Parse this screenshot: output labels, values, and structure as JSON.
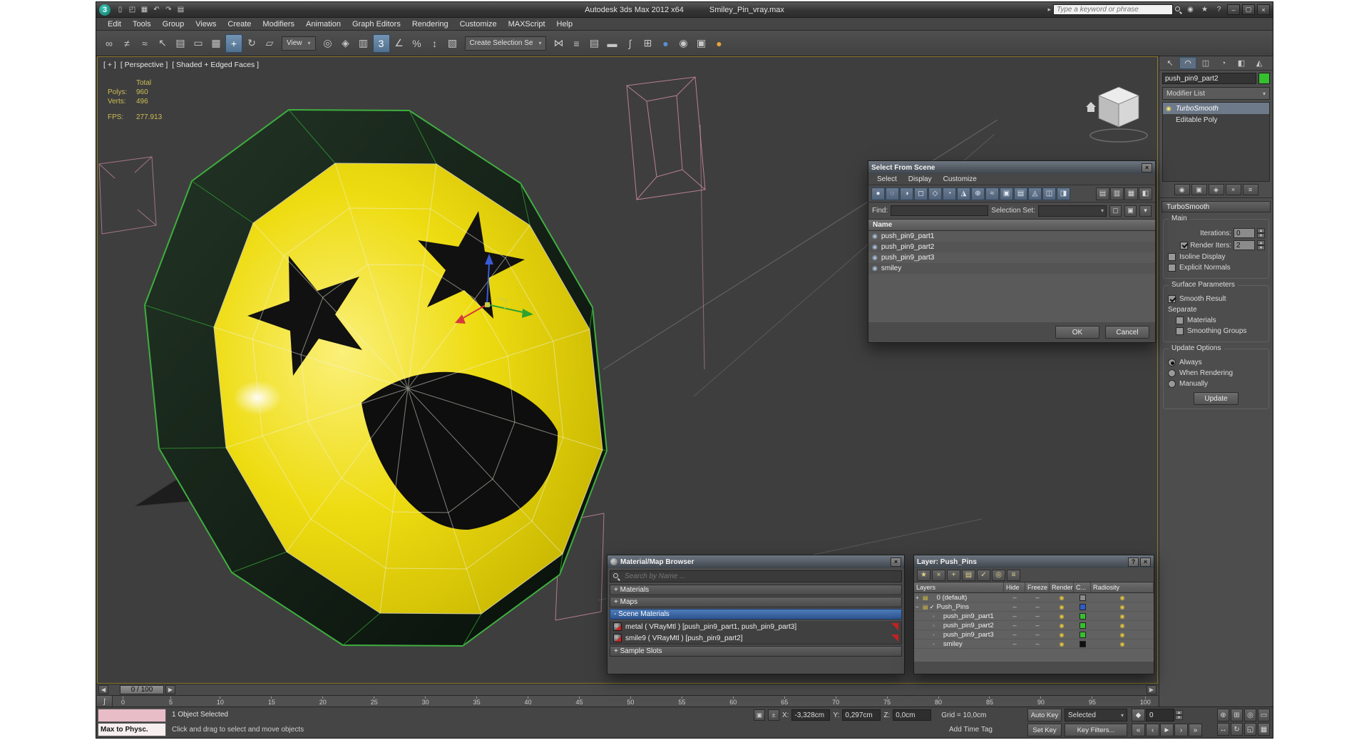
{
  "glyphs": {
    "close": "×",
    "help": "?",
    "minimize": "–",
    "maximize": "▢",
    "combo_arrow": "▾",
    "spin_up": "▴",
    "spin_down": "▾",
    "left": "◀",
    "right": "▶",
    "t_start": "«",
    "t_prev": "‹",
    "t_play": "►",
    "t_next": "›",
    "t_end": "»",
    "check": "✓",
    "curve": "∫",
    "key": "◆",
    "lock": "▣",
    "abs": "±",
    "geometry": "◉",
    "render_dot": "◉",
    "collapse": "▸"
  },
  "window": {
    "app_title": "Autodesk 3ds Max 2012 x64",
    "doc_title": "Smiley_Pin_vray.max",
    "search_placeholder": "Type a keyword or phrase"
  },
  "quick_access": [
    {
      "name": "new-scene-icon",
      "glyph": "▯"
    },
    {
      "name": "open-file-icon",
      "glyph": "◰"
    },
    {
      "name": "save-file-icon",
      "glyph": "▦"
    },
    {
      "name": "undo-icon",
      "glyph": "↶"
    },
    {
      "name": "redo-icon",
      "glyph": "↷"
    },
    {
      "name": "project-folder-icon",
      "glyph": "▤"
    }
  ],
  "infocenter": [
    {
      "name": "sign-in-icon",
      "glyph": "◉"
    },
    {
      "name": "favorites-icon",
      "glyph": "★"
    },
    {
      "name": "help-icon",
      "glyph": "?"
    }
  ],
  "menus": [
    "Edit",
    "Tools",
    "Group",
    "Views",
    "Create",
    "Modifiers",
    "Animation",
    "Graph Editors",
    "Rendering",
    "Customize",
    "MAXScript",
    "Help"
  ],
  "toolbar": {
    "view_combo": "View",
    "selection_combo": "Create Selection Se",
    "items_a": [
      {
        "name": "select-and-link-icon",
        "glyph": "∞"
      },
      {
        "name": "unlink-selection-icon",
        "glyph": "≠"
      },
      {
        "name": "bind-to-space-warp-icon",
        "glyph": "≈"
      },
      {
        "name": "select-object-icon",
        "glyph": "↖"
      },
      {
        "name": "select-by-name-icon",
        "glyph": "▤"
      },
      {
        "name": "rectangular-selection-icon",
        "glyph": "▭"
      },
      {
        "name": "window-crossing-icon",
        "glyph": "▦"
      },
      {
        "name": "select-and-move-icon",
        "glyph": "+",
        "active": true
      },
      {
        "name": "select-and-rotate-icon",
        "glyph": "↻"
      },
      {
        "name": "select-and-scale-icon",
        "glyph": "▱"
      }
    ],
    "items_b": [
      {
        "name": "use-center-icon",
        "glyph": "◎"
      },
      {
        "name": "select-and-manipulate-icon",
        "glyph": "◈"
      },
      {
        "name": "keyboard-override-icon",
        "glyph": "▥"
      },
      {
        "name": "snaps-toggle-icon",
        "glyph": "3",
        "active": true
      },
      {
        "name": "angle-snap-icon",
        "glyph": "∠"
      },
      {
        "name": "percent-snap-icon",
        "glyph": "%"
      },
      {
        "name": "spinner-snap-icon",
        "glyph": "↕"
      },
      {
        "name": "edit-named-selection-sets-icon",
        "glyph": "▧"
      }
    ],
    "items_c": [
      {
        "name": "mirror-icon",
        "glyph": "⋈"
      },
      {
        "name": "align-icon",
        "glyph": "≡"
      },
      {
        "name": "layer-manager-icon",
        "glyph": "▤"
      },
      {
        "name": "ribbon-toggle-icon",
        "glyph": "▬"
      },
      {
        "name": "curve-editor-icon",
        "glyph": "∫"
      },
      {
        "name": "schematic-view-icon",
        "glyph": "⊞"
      },
      {
        "name": "material-editor-icon",
        "glyph": "●",
        "color": "#5b8fd4"
      },
      {
        "name": "render-setup-icon",
        "glyph": "◉",
        "color": "#c8c8c8"
      },
      {
        "name": "rendered-frame-icon",
        "glyph": "▣"
      },
      {
        "name": "render-production-icon",
        "glyph": "●",
        "color": "#e8a43a"
      }
    ]
  },
  "viewport": {
    "label_plus": "[ + ]",
    "label_view": "[ Perspective ]",
    "label_shading": "[ Shaded + Edged Faces ]",
    "stats": {
      "total": "Total",
      "polys_label": "Polys:",
      "polys": "960",
      "verts_label": "Verts:",
      "verts": "496",
      "fps_label": "FPS:",
      "fps": "277.913"
    }
  },
  "scene_dialog": {
    "title": "Select From Scene",
    "menus": [
      "Select",
      "Display",
      "Customize"
    ],
    "tools": [
      {
        "name": "display-all-icon",
        "glyph": "●"
      },
      {
        "name": "display-none-icon",
        "glyph": "◌"
      },
      {
        "name": "display-invert-icon",
        "glyph": "◑"
      },
      {
        "name": "display-geometry-icon",
        "glyph": "◻"
      },
      {
        "name": "display-shapes-icon",
        "glyph": "◇"
      },
      {
        "name": "display-lights-icon",
        "glyph": "◔"
      },
      {
        "name": "display-cameras-icon",
        "glyph": "◮"
      },
      {
        "name": "display-helpers-icon",
        "glyph": "⊕"
      },
      {
        "name": "display-spacewarps-icon",
        "glyph": "≈"
      },
      {
        "name": "display-groups-icon",
        "glyph": "▣"
      },
      {
        "name": "display-xrefs-icon",
        "glyph": "▤"
      },
      {
        "name": "display-bones-icon",
        "glyph": "◬"
      },
      {
        "name": "display-containers-icon",
        "glyph": "◫"
      },
      {
        "name": "display-frozen-icon",
        "glyph": "◨"
      }
    ],
    "views": [
      {
        "name": "list-view-icon",
        "glyph": "▤"
      },
      {
        "name": "column-view-icon",
        "glyph": "▥"
      },
      {
        "name": "detail-view-icon",
        "glyph": "▦"
      },
      {
        "name": "choose-columns-icon",
        "glyph": "◧"
      }
    ],
    "find_label": "Find:",
    "selection_set_label": "Selection Set:",
    "name_header": "Name",
    "items": [
      {
        "name": "push_pin9_part1"
      },
      {
        "name": "push_pin9_part2"
      },
      {
        "name": "push_pin9_part3"
      },
      {
        "name": "smiley"
      }
    ],
    "ok": "OK",
    "cancel": "Cancel"
  },
  "panel": {
    "object_name": "push_pin9_part2",
    "object_color": "#35c12e",
    "modifier_list": "Modifier List",
    "tabs": [
      {
        "name": "tab-create",
        "glyph": "↖"
      },
      {
        "name": "tab-modify",
        "glyph": "◠",
        "active": true
      },
      {
        "name": "tab-hierarchy",
        "glyph": "◫"
      },
      {
        "name": "tab-motion",
        "glyph": "◔"
      },
      {
        "name": "tab-display",
        "glyph": "◧"
      },
      {
        "name": "tab-utilities",
        "glyph": "◭"
      }
    ],
    "stack": [
      {
        "name": "TurboSmooth",
        "icon": "◉",
        "selected": true,
        "italic": true
      },
      {
        "name": "Editable Poly",
        "icon": "",
        "selected": false
      }
    ],
    "stack_tools": [
      {
        "name": "pin-stack-icon",
        "glyph": "◉"
      },
      {
        "name": "show-end-result-icon",
        "glyph": "▣"
      },
      {
        "name": "make-unique-icon",
        "glyph": "◈"
      },
      {
        "name": "remove-modifier-icon",
        "glyph": "×"
      },
      {
        "name": "configure-modifier-sets-icon",
        "glyph": "≡"
      }
    ],
    "turbosmooth": {
      "title": "TurboSmooth",
      "main": "Main",
      "iterations_label": "Iterations:",
      "iterations": "0",
      "render_iters_label": "Render Iters:",
      "render_iters": "2",
      "isoline": "Isoline Display",
      "explicit_normals": "Explicit Normals",
      "surface": "Surface Parameters",
      "smooth_result": "Smooth Result",
      "separate": "Separate",
      "materials": "Materials",
      "smoothing_groups": "Smoothing Groups",
      "update_options": "Update Options",
      "always": "Always",
      "when_rendering": "When Rendering",
      "manually": "Manually",
      "update": "Update"
    }
  },
  "material_browser": {
    "title": "Material/Map Browser",
    "search_placeholder": "Search by Name ...",
    "materials_header": "+ Materials",
    "maps_header": "+ Maps",
    "scene_materials_header": "- Scene Materials",
    "entries": [
      {
        "label": "metal ( VRayMtl ) [push_pin9_part1, push_pin9_part3]"
      },
      {
        "label": "smile9 ( VRayMtl ) [push_pin9_part2]"
      }
    ],
    "sample_slots_header": "+ Sample Slots"
  },
  "layer_dialog": {
    "title": "Layer: Push_Pins",
    "columns": [
      "Layers",
      "Hide",
      "Freeze",
      "Render",
      "C...",
      "Radiosity"
    ],
    "tools": [
      {
        "name": "create-layer-icon",
        "glyph": "★"
      },
      {
        "name": "delete-layer-icon",
        "glyph": "×"
      },
      {
        "name": "add-to-layer-icon",
        "glyph": "+"
      },
      {
        "name": "select-in-layer-icon",
        "glyph": "▤"
      },
      {
        "name": "set-current-layer-icon",
        "glyph": "✓"
      },
      {
        "name": "highlight-layer-icon",
        "glyph": "◎"
      },
      {
        "name": "layer-properties-icon",
        "glyph": "≡"
      }
    ],
    "rows": [
      {
        "name": "0 (default)",
        "level": 0,
        "twist": "+",
        "check": "",
        "icon": "▤",
        "icon_color": "#d8c040",
        "hide": "–",
        "freeze": "–",
        "color": "#8a8a8a"
      },
      {
        "name": "Push_Pins",
        "level": 0,
        "twist": "−",
        "check": "✓",
        "icon": "▤",
        "icon_color": "#d8c040",
        "hide": "–",
        "freeze": "–",
        "color": "#2e5ccc"
      },
      {
        "name": "push_pin9_part1",
        "level": 1,
        "twist": "",
        "check": "",
        "icon": "◦",
        "icon_color": "#cccccc",
        "hide": "–",
        "freeze": "–",
        "color": "#35c12e"
      },
      {
        "name": "push_pin9_part2",
        "level": 1,
        "twist": "",
        "check": "",
        "icon": "◦",
        "icon_color": "#cccccc",
        "hide": "–",
        "freeze": "–",
        "color": "#35c12e"
      },
      {
        "name": "push_pin9_part3",
        "level": 1,
        "twist": "",
        "check": "",
        "icon": "◦",
        "icon_color": "#cccccc",
        "hide": "–",
        "freeze": "–",
        "color": "#35c12e"
      },
      {
        "name": "smiley",
        "level": 1,
        "twist": "",
        "check": "",
        "icon": "◦",
        "icon_color": "#cccccc",
        "hide": "–",
        "freeze": "–",
        "color": "#101010"
      }
    ]
  },
  "timeline": {
    "slider_value": "0 / 100",
    "ticks": [
      "0",
      "5",
      "10",
      "15",
      "20",
      "25",
      "30",
      "35",
      "40",
      "45",
      "50",
      "55",
      "60",
      "65",
      "70",
      "75",
      "80",
      "85",
      "90",
      "95",
      "100"
    ]
  },
  "status": {
    "selection": "1 Object Selected",
    "prompt": "Click and drag to select and move objects",
    "listener_text": "Max to Physc.",
    "x_label": "X:",
    "x": "-3,328cm",
    "y_label": "Y:",
    "y": "0,297cm",
    "z_label": "Z:",
    "z": "0,0cm",
    "grid": "Grid = 10,0cm",
    "add_time_tag": "Add Time Tag",
    "auto_key": "Auto Key",
    "set_key": "Set Key",
    "selected_combo": "Selected",
    "key_filters": "Key Filters...",
    "frame": "0"
  },
  "nav_icons": [
    {
      "name": "zoom-icon",
      "glyph": "⊕"
    },
    {
      "name": "zoom-all-icon",
      "glyph": "⊞"
    },
    {
      "name": "zoom-extents-icon",
      "glyph": "◎"
    },
    {
      "name": "zoom-region-icon",
      "glyph": "▭"
    },
    {
      "name": "pan-icon",
      "glyph": "↔"
    },
    {
      "name": "orbit-icon",
      "glyph": "↻"
    },
    {
      "name": "maximize-viewport-icon",
      "glyph": "◱"
    },
    {
      "name": "viewport-layout-icon",
      "glyph": "▦"
    }
  ]
}
